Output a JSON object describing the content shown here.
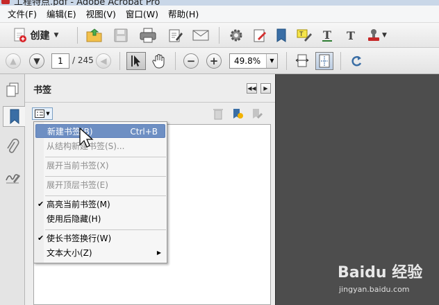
{
  "window": {
    "title": "工程特点.pdf - Adobe Acrobat Pro"
  },
  "menubar": [
    {
      "label": "文件(F)"
    },
    {
      "label": "编辑(E)"
    },
    {
      "label": "视图(V)"
    },
    {
      "label": "窗口(W)"
    },
    {
      "label": "帮助(H)"
    }
  ],
  "toolbar": {
    "create_label": "创建",
    "icons": [
      "create-pdf-icon",
      "open-folder-icon",
      "save-icon",
      "print-icon",
      "edit-icon",
      "email-icon",
      "settings-gear-icon",
      "sign-icon",
      "bookmark-icon",
      "highlight-icon",
      "text-underline-icon",
      "text-icon",
      "stamp-icon"
    ]
  },
  "navigation": {
    "current_page": "1",
    "page_total": "/ 245",
    "zoom": "49.8%"
  },
  "panel": {
    "title": "书签"
  },
  "context_menu": {
    "items": [
      {
        "label": "新建书签(B)",
        "shortcut": "Ctrl+B",
        "disabled": false,
        "checked": false,
        "highlighted": true
      },
      {
        "label": "从结构新建书签(S)...",
        "shortcut": "",
        "disabled": true,
        "checked": false,
        "highlighted": false
      },
      {
        "label": "展开当前书签(X)",
        "shortcut": "",
        "disabled": true,
        "checked": false,
        "highlighted": false
      },
      {
        "label": "展开顶层书签(E)",
        "shortcut": "",
        "disabled": true,
        "checked": false,
        "highlighted": false
      },
      {
        "label": "高亮当前书签(M)",
        "shortcut": "",
        "disabled": false,
        "checked": true,
        "highlighted": false
      },
      {
        "label": "使用后隐藏(H)",
        "shortcut": "",
        "disabled": false,
        "checked": false,
        "highlighted": false
      },
      {
        "label": "使长书签换行(W)",
        "shortcut": "",
        "disabled": false,
        "checked": true,
        "highlighted": false
      },
      {
        "label": "文本大小(Z)",
        "shortcut": "",
        "disabled": false,
        "checked": false,
        "highlighted": false,
        "submenu": true
      }
    ]
  },
  "watermark": {
    "brand": "Baidu 经验",
    "url": "jingyan.baidu.com"
  },
  "colors": {
    "doc_background": "#4d4d4d",
    "menu_highlight": "#6e8fc3",
    "panel_background": "#ededed"
  }
}
